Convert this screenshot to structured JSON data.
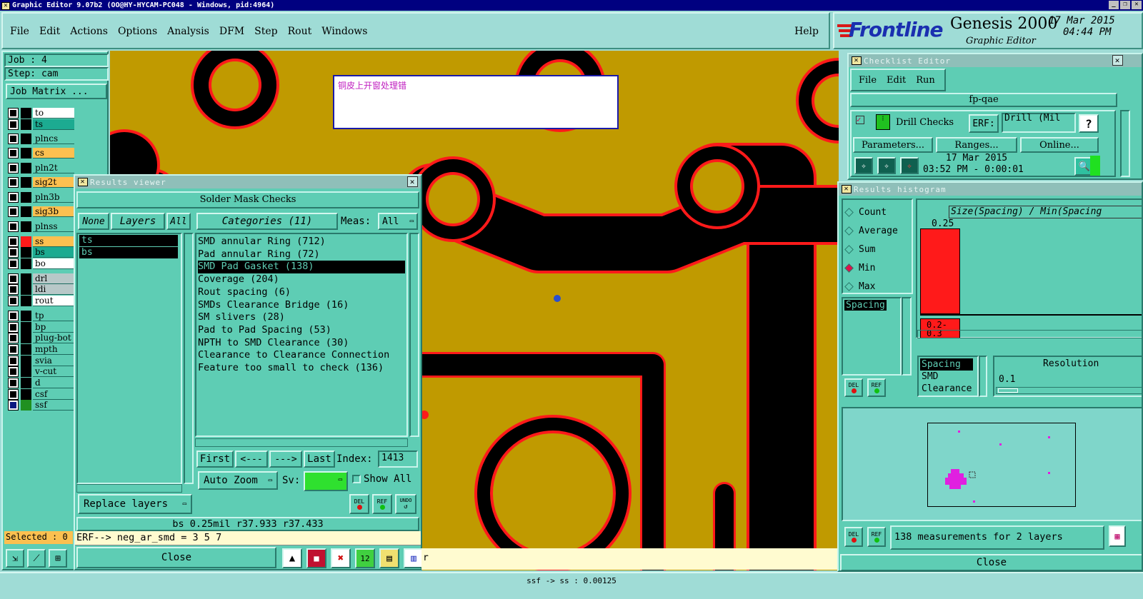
{
  "titlebar": {
    "text": "Graphic Editor 9.07b2 (OO@HY-HYCAM-PC048 - Windows, pid:4964)"
  },
  "menu": {
    "items": [
      "File",
      "Edit",
      "Actions",
      "Options",
      "Analysis",
      "DFM",
      "Step",
      "Rout",
      "Windows"
    ],
    "help": "Help"
  },
  "brand": {
    "logo": "Frontline",
    "product": "Genesis 2000",
    "subtitle": "Graphic Editor",
    "date": "17 Mar 2015",
    "time": "04:44 PM"
  },
  "job": {
    "job_label": "Job : 4",
    "step_label": "Step: cam",
    "matrix_button": "Job Matrix ..."
  },
  "layers": [
    {
      "name": "to",
      "color": "#ffffff"
    },
    {
      "name": "ts",
      "color": "#1cab91"
    },
    {
      "name": "plncs",
      "color": "#5ecdb4"
    },
    {
      "name": "cs",
      "color": "#fcc050"
    },
    {
      "name": "pln2t",
      "color": "#5ecdb4"
    },
    {
      "name": "sig2t",
      "color": "#fcc050"
    },
    {
      "name": "pln3b",
      "color": "#5ecdb4"
    },
    {
      "name": "sig3b",
      "color": "#fcc050"
    },
    {
      "name": "plnss",
      "color": "#5ecdb4"
    },
    {
      "name": "ss",
      "color": "#fcc050"
    },
    {
      "name": "bs",
      "color": "#1cab91"
    },
    {
      "name": "bo",
      "color": "#ffffff"
    },
    {
      "name": "drl",
      "color": "#b8c8c8"
    },
    {
      "name": "ldi",
      "color": "#b8c8c8"
    },
    {
      "name": "rout",
      "color": "#ffffff"
    },
    {
      "name": "tp",
      "color": "#5ecdb4"
    },
    {
      "name": "bp",
      "color": "#5ecdb4"
    },
    {
      "name": "plug-bot",
      "color": "#5ecdb4"
    },
    {
      "name": "mpth",
      "color": "#5ecdb4"
    },
    {
      "name": "svia",
      "color": "#5ecdb4"
    },
    {
      "name": "v-cut",
      "color": "#5ecdb4"
    },
    {
      "name": "d",
      "color": "#5ecdb4"
    },
    {
      "name": "csf",
      "color": "#5ecdb4"
    },
    {
      "name": "ssf",
      "color": "#5ecdb4"
    }
  ],
  "selected": "Selected : 0",
  "canvas": {
    "annotation": "铜皮上开窗处理错"
  },
  "results_viewer": {
    "title": "Results viewer",
    "header": "Solder Mask Checks",
    "none_btn": "None",
    "layers_btn": "Layers",
    "all_btn": "All",
    "categories_btn": "Categories (11)",
    "meas_label": "Meas:",
    "meas_value": "All",
    "layer_list": [
      "ts",
      "bs"
    ],
    "categories": [
      "SMD annular Ring (712)",
      "Pad annular Ring (72)",
      "SMD Pad Gasket (138)",
      "Coverage (204)",
      "Rout spacing (6)",
      "SMDs Clearance Bridge (16)",
      "SM slivers (28)",
      "Pad to Pad Spacing (53)",
      "NPTH to SMD Clearance (30)",
      "Clearance to Clearance Connection",
      "Feature too small to check (136)"
    ],
    "selected_index": 2,
    "first_btn": "First",
    "prev_btn": "<---",
    "next_btn": "--->",
    "last_btn": "Last",
    "index_label": "Index:",
    "index_value": "1413",
    "autozoom_btn": "Auto Zoom",
    "sv_label": "Sv:",
    "show_all": "Show All",
    "replace_btn": "Replace layers",
    "del": "DEL",
    "ref": "REF",
    "undo": "UNDO",
    "status": "bs 0.25mil  r37.933  r37.433",
    "erf": "ERF--> neg_ar_smd = 3 5 7",
    "close": "Close"
  },
  "checklist": {
    "title": "Checklist Editor",
    "menu": [
      "File",
      "Edit",
      "Run"
    ],
    "name": "fp-qae",
    "check_name": "Drill Checks",
    "erf_label": "ERF:",
    "erf_value": "Drill (Mil",
    "help": "?",
    "params_btn": "Parameters...",
    "ranges_btn": "Ranges...",
    "online_btn": "Online...",
    "date": "17 Mar 2015",
    "time": "03:52 PM - 0:00:01"
  },
  "histogram": {
    "title": "Results histogram",
    "options": [
      "Count",
      "Average",
      "Sum",
      "Min",
      "Max"
    ],
    "selected_option": "Min",
    "header": "Size(Spacing) / Min(Spacing",
    "bar_value_label": "0.25",
    "bar_fraction": 1.0,
    "bin_label_1": "0.2-",
    "bin_label_2": "0.3",
    "param_list": [
      "Spacing"
    ],
    "meas_list": [
      "Spacing",
      "SMD",
      "Clearance"
    ],
    "resolution_label": "Resolution",
    "resolution_value": "0.1",
    "summary": "138 measurements for 2 layers",
    "close": "Close"
  },
  "bottom_status": "ssf -> ss : 0.00125",
  "colors": {
    "bg": "#9fdcd6",
    "panel": "#5ecdb4",
    "copper": "#c09a00",
    "mask": "#ff1a1a"
  }
}
